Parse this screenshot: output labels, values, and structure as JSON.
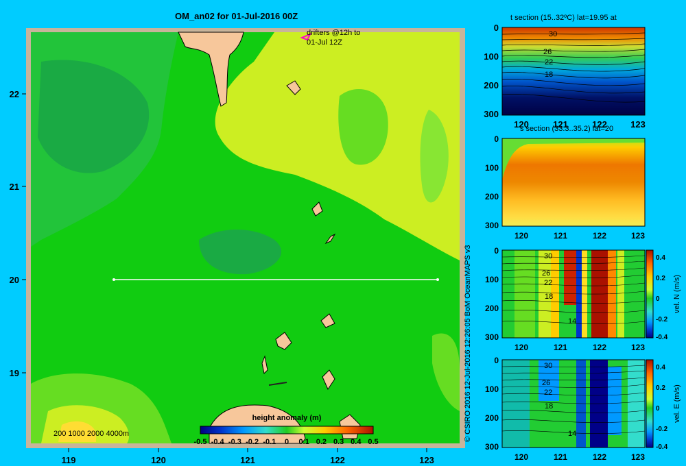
{
  "main_map": {
    "title": "OM_an02 for 01-Jul-2016 00Z",
    "drifter_legend": [
      "drifters @12h to",
      "01-Jul 12Z"
    ],
    "lon_ticks": [
      "119",
      "120",
      "121",
      "122",
      "123"
    ],
    "lat_ticks": [
      "22",
      "21",
      "20",
      "19"
    ],
    "depth_legend": "200  1000  2000  4000m",
    "colorbar": {
      "label": "height anomaly  (m)",
      "ticks": [
        "-0.5",
        "-0.4",
        "-0.3",
        "-0.2",
        "-0.1",
        "0",
        "0.1",
        "0.2",
        "0.3",
        "0.4",
        "0.5"
      ],
      "range": [
        -0.5,
        0.5
      ]
    },
    "section_line": {
      "lat": 20,
      "lon_start": 119.5,
      "lon_end": 123.2
    }
  },
  "credit": "© CSIRO 2016   12-Jul-2016 12:26:05 BoM OceanMAPS v3",
  "section_panels": [
    {
      "title": "t section (15..32ºC) lat=19.95 at",
      "x_ticks": [
        "120",
        "121",
        "122",
        "123"
      ],
      "y_ticks": [
        "0",
        "100",
        "200",
        "300"
      ],
      "contour_labels": [
        "30",
        "26",
        "22",
        "18"
      ]
    },
    {
      "title": "s section (33.3..35.2) lat=20",
      "x_ticks": [
        "120",
        "121",
        "122",
        "123"
      ],
      "y_ticks": [
        "0",
        "100",
        "200",
        "300"
      ]
    },
    {
      "colorbar_label": "vel. N (m/s)",
      "x_ticks": [
        "120",
        "121",
        "122",
        "123"
      ],
      "y_ticks": [
        "0",
        "100",
        "200",
        "300"
      ],
      "contour_labels": [
        "30",
        "26",
        "22",
        "18",
        "14"
      ],
      "colorbar_ticks": [
        "0.4",
        "0.2",
        "0",
        "-0.2",
        "-0.4"
      ]
    },
    {
      "colorbar_label": "vel. E (m/s)",
      "x_ticks": [
        "120",
        "121",
        "122",
        "123"
      ],
      "y_ticks": [
        "0",
        "100",
        "200",
        "300"
      ],
      "contour_labels": [
        "30",
        "26",
        "22",
        "18",
        "14"
      ],
      "colorbar_ticks": [
        "0.4",
        "0.2",
        "0",
        "-0.2",
        "-0.4"
      ]
    }
  ],
  "colors": {
    "background": "#00ccff",
    "land": "#f7c79b",
    "frame": "#c8b49b"
  }
}
